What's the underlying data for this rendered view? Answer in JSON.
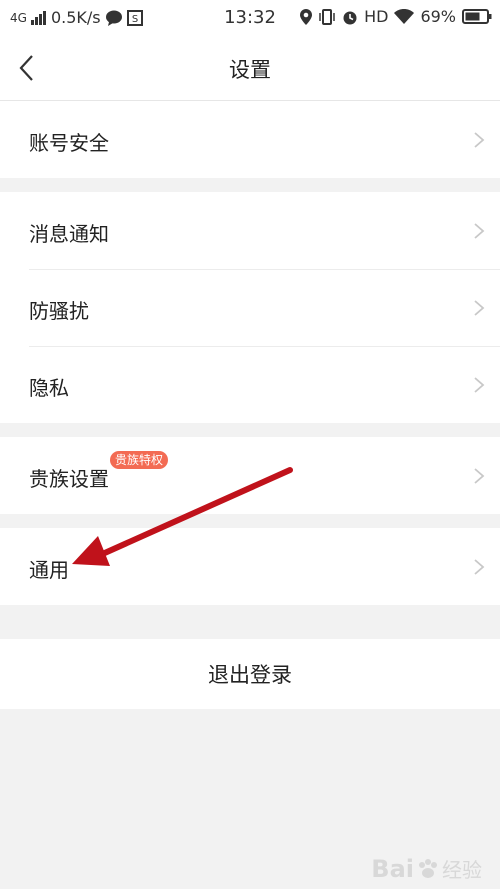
{
  "status_bar": {
    "network": "4G",
    "speed": "0.5K/s",
    "time": "13:32",
    "hd": "HD",
    "battery": "69%"
  },
  "nav": {
    "title": "设置"
  },
  "groups": [
    {
      "items": [
        {
          "label": "账号安全"
        }
      ]
    },
    {
      "items": [
        {
          "label": "消息通知"
        },
        {
          "label": "防骚扰"
        },
        {
          "label": "隐私"
        }
      ]
    },
    {
      "items": [
        {
          "label": "贵族设置",
          "badge": "贵族特权"
        }
      ]
    },
    {
      "items": [
        {
          "label": "通用"
        }
      ]
    }
  ],
  "logout_label": "退出登录",
  "watermark": {
    "brand": "Bai",
    "suffix": "经验"
  },
  "colors": {
    "badge": "#f36b53",
    "arrow": "#c0121b",
    "background": "#f2f2f2"
  }
}
